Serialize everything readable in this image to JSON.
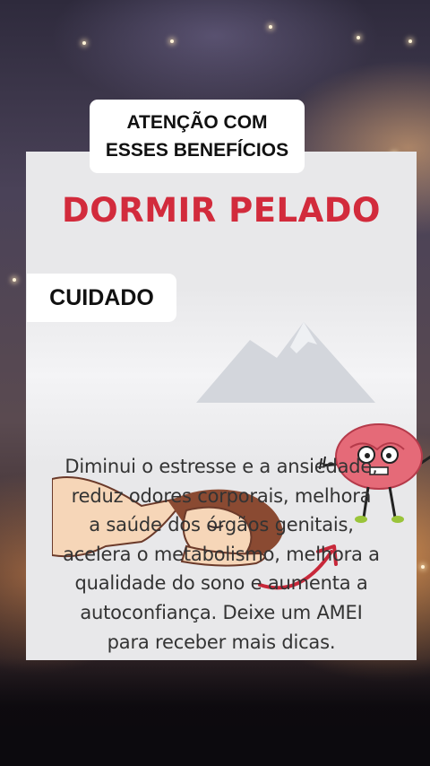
{
  "overlay": {
    "warning_line1": "ATENÇÃO COM",
    "warning_line2": "ESSES BENEFÍCIOS",
    "caution_label": "CUIDADO"
  },
  "card": {
    "headline": "DORMIR PELADO",
    "body_lines": [
      "Diminui o estresse e a ansiedade,",
      "reduz odores corporais, melhora",
      "a saúde dos órgãos genitais,",
      "acelera o metabolismo, melhora a",
      "qualidade do sono e aumenta a",
      "autoconfiança. Deixe um AMEI",
      "para receber mais dicas."
    ]
  },
  "icons": {
    "sleeping": "sleeping-person-illustration",
    "brain": "brain-character-illustration",
    "arrow": "curved-arrow-icon"
  },
  "colors": {
    "headline": "#d22b3c",
    "arrow": "#c8283a",
    "card": "#e8e8ea",
    "label_bg": "#ffffff"
  }
}
